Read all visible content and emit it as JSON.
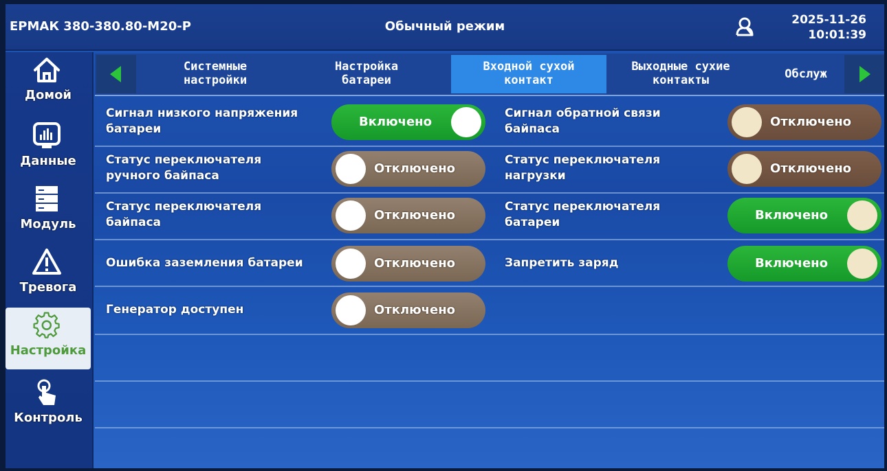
{
  "header": {
    "model": "ЕРМАК 380-380.80-М20-Р",
    "mode": "Обычный режим",
    "date": "2025-11-26",
    "time": "10:01:39"
  },
  "sidebar": {
    "items": [
      {
        "label": "Домой",
        "icon": "home-icon"
      },
      {
        "label": "Данные",
        "icon": "chart-icon"
      },
      {
        "label": "Модуль",
        "icon": "server-icon"
      },
      {
        "label": "Тревога",
        "icon": "warning-icon"
      },
      {
        "label": "Настройка",
        "icon": "gear-icon",
        "active": true
      },
      {
        "label": "Контроль",
        "icon": "touch-icon"
      }
    ]
  },
  "tabs": [
    {
      "label": "Системные\nнастройки"
    },
    {
      "label": "Настройка\nбатареи"
    },
    {
      "label": "Входной сухой\nконтакт",
      "active": true
    },
    {
      "label": "Выходные сухие\nконтакты"
    },
    {
      "label": "Обслуж"
    }
  ],
  "settings": {
    "left": [
      {
        "label": "Сигнал низкого напряжения\nбатареи",
        "state": "Включено"
      },
      {
        "label": "Статус переключателя\nручного байпаса",
        "state": "Отключено"
      },
      {
        "label": "Статус переключателя\nбайпаса",
        "state": "Отключено"
      },
      {
        "label": "Ошибка заземления батареи",
        "state": "Отключено"
      },
      {
        "label": "Генератор доступен",
        "state": "Отключено"
      }
    ],
    "right": [
      {
        "label": "Сигнал обратной связи\nбайпаса",
        "state": "Отключено"
      },
      {
        "label": "Статус переключателя\nнагрузки",
        "state": "Отключено"
      },
      {
        "label": "Статус переключателя\nбатареи",
        "state": "Включено"
      },
      {
        "label": "Запретить заряд",
        "state": "Включено"
      }
    ]
  },
  "colors": {
    "on": "#1fa830",
    "off": "#8a7562",
    "accent_tab": "#2d88e6"
  }
}
